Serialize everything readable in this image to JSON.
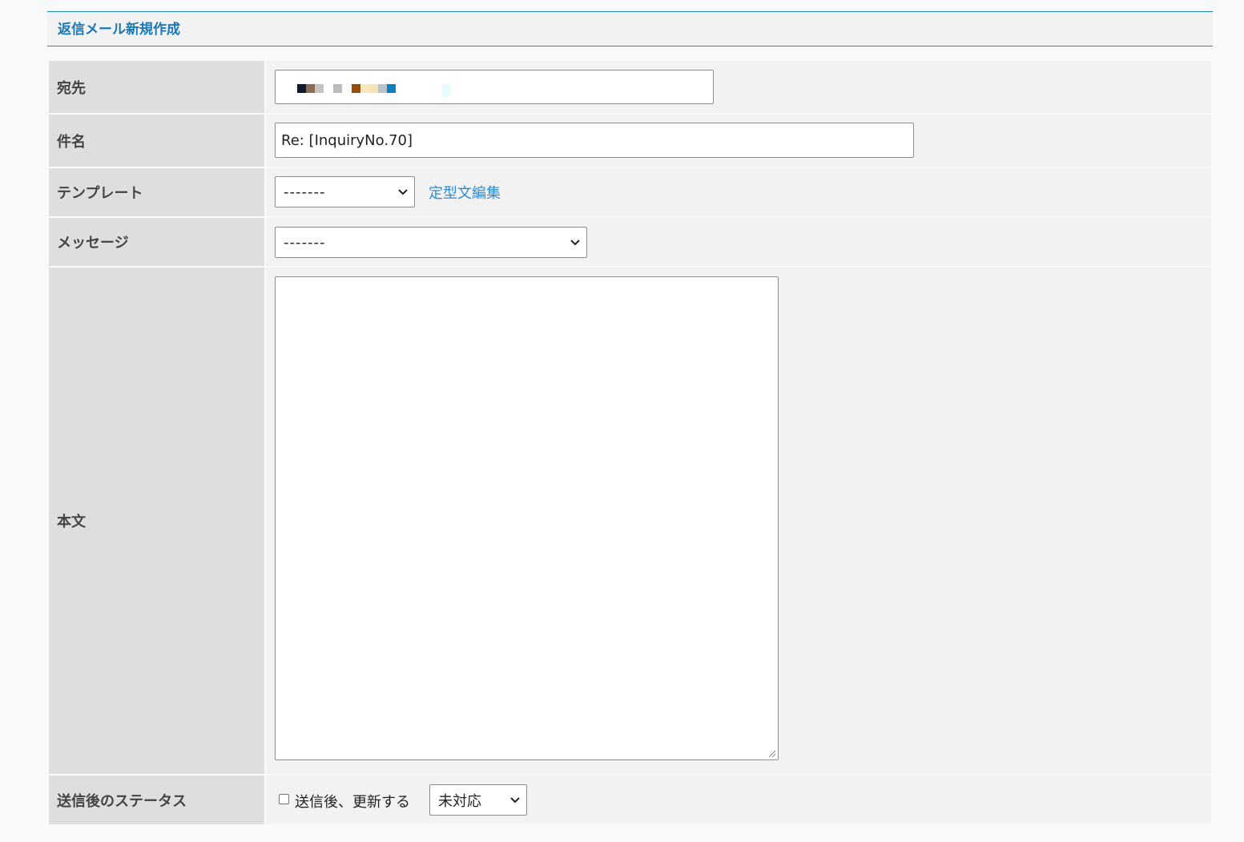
{
  "header": {
    "title": "返信メール新規作成"
  },
  "form": {
    "recipient": {
      "label": "宛先",
      "value": ""
    },
    "subject": {
      "label": "件名",
      "value": "Re: [InquiryNo.70]"
    },
    "template": {
      "label": "テンプレート",
      "selected": "-------",
      "edit_link": "定型文編集"
    },
    "message": {
      "label": "メッセージ",
      "selected": "-------"
    },
    "body": {
      "label": "本文",
      "value": ""
    },
    "status_after_send": {
      "label": "送信後のステータス",
      "checkbox_label": "送信後、更新する",
      "checked": false,
      "selected": "未対応"
    }
  },
  "colors": {
    "accent": "#1b78b4",
    "link": "#2f8ad1",
    "label_bg": "#dedede",
    "value_bg": "#f2f2f2"
  }
}
